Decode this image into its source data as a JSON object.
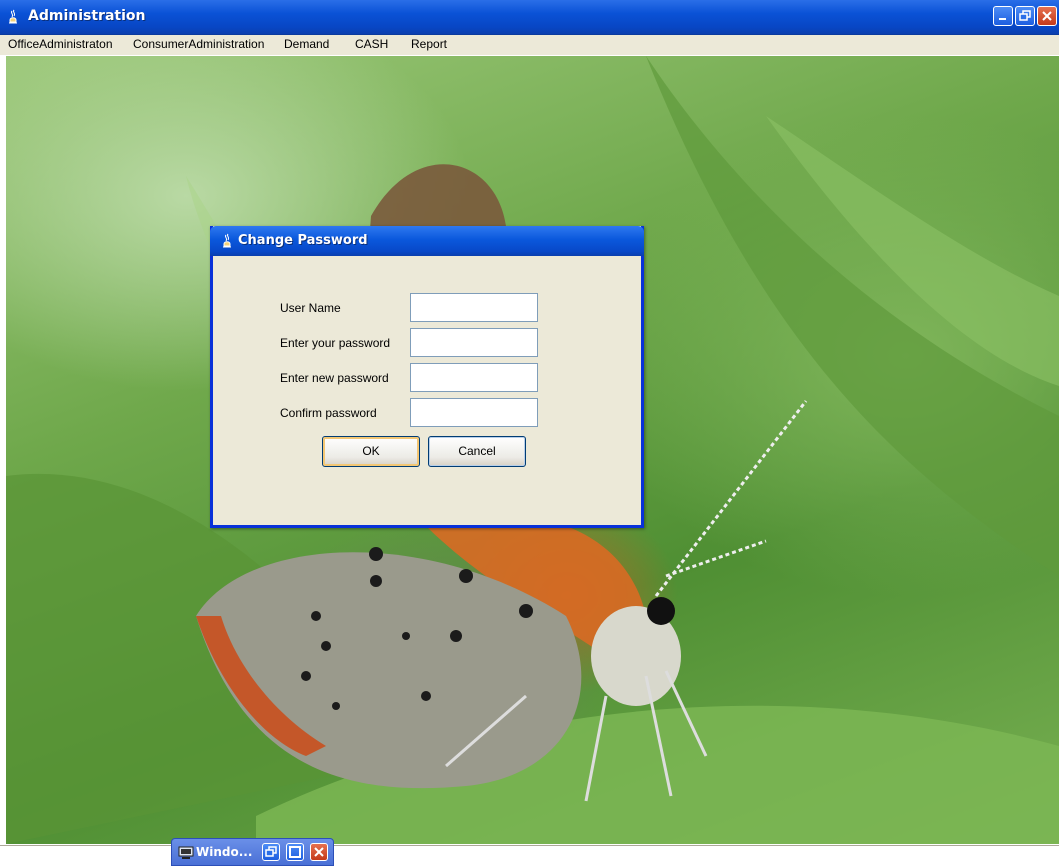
{
  "window": {
    "title": "Administration",
    "icon": "java-coffee-icon"
  },
  "menu": {
    "items": [
      {
        "label": "OfficeAdministraton"
      },
      {
        "label": "ConsumerAdministration"
      },
      {
        "label": "Demand"
      },
      {
        "label": "CASH"
      },
      {
        "label": "Report"
      }
    ]
  },
  "dialog": {
    "title": "Change Password",
    "fields": [
      {
        "label": "User Name",
        "value": ""
      },
      {
        "label": "Enter your password",
        "value": ""
      },
      {
        "label": "Enter new  password",
        "value": ""
      },
      {
        "label": "Confirm   password",
        "value": ""
      }
    ],
    "ok_label": "OK",
    "cancel_label": "Cancel"
  },
  "minimized_window": {
    "title": "Windo..."
  },
  "colors": {
    "titlebar": "#0a52d6",
    "close": "#c53a1a",
    "menubar": "#ece9d8"
  }
}
